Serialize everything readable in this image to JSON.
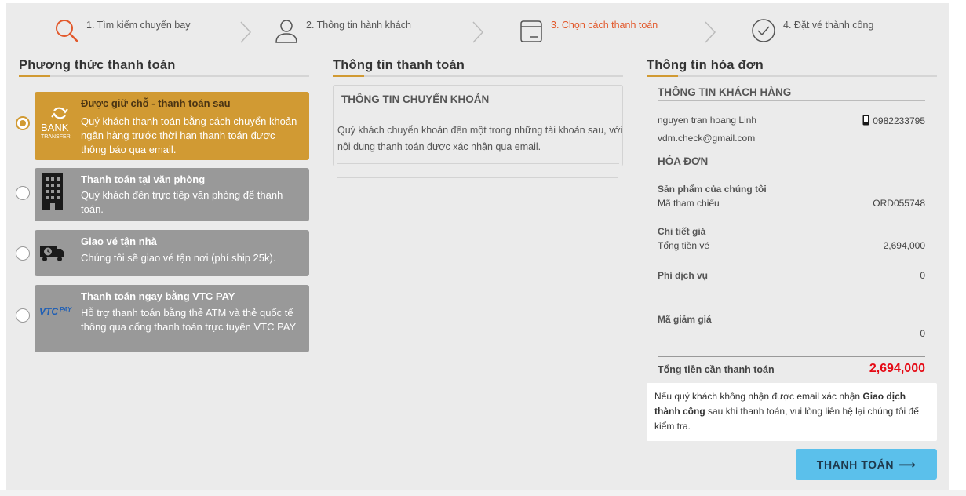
{
  "stepper": {
    "steps": [
      {
        "label": "1. Tìm kiếm chuyến bay",
        "icon": "search-icon"
      },
      {
        "label": "2. Thông tin hành khách",
        "icon": "user-icon"
      },
      {
        "label": "3. Chọn cách thanh toán",
        "icon": "wallet-icon",
        "active": true
      },
      {
        "label": "4. Đặt vé thành công",
        "icon": "check-circle-icon"
      }
    ],
    "active_color": "#e2592c"
  },
  "payment_methods": {
    "heading": "Phương thức thanh toán",
    "options": [
      {
        "title": "Được giữ chỗ - thanh toán sau",
        "desc": "Quý khách thanh toán bằng cách chuyển khoản ngân hàng trước thời hạn thanh toán được thông báo qua email.",
        "icon": "bank-transfer-icon",
        "icon_text_1": "BANK",
        "icon_text_2": "TRANSFER",
        "selected": true
      },
      {
        "title": "Thanh toán tại văn phòng",
        "desc": "Quý khách đến trực tiếp văn phòng để thanh toán.",
        "icon": "building-icon"
      },
      {
        "title": "Giao vé tận nhà",
        "desc": "Chúng tôi sẽ giao vé tận nơi (phí ship 25k).",
        "icon": "delivery-truck-icon"
      },
      {
        "title": "Thanh toán ngay bằng VTC PAY",
        "desc": "Hỗ trợ thanh toán bằng thẻ ATM và thẻ quốc tế thông qua cổng thanh toán trực tuyến VTC PAY",
        "icon": "vtc-pay-logo"
      }
    ]
  },
  "payment_info": {
    "heading": "Thông tin thanh toán",
    "box_title": "THÔNG TIN CHUYỂN KHOẢN",
    "box_text": "Quý khách chuyển khoản đến một trong những tài khoản sau, với nội dung thanh toán được xác nhận qua email."
  },
  "invoice": {
    "heading": "Thông tin hóa đơn",
    "customer_section": "THÔNG TIN KHÁCH HÀNG",
    "customer_name": "nguyen tran hoang Linh",
    "customer_phone": "0982233795",
    "customer_email": "vdm.check@gmail.com",
    "invoice_section": "HÓA ĐƠN",
    "product_label": "Sản phẩm của chúng tôi",
    "ref_label": "Mã tham chiếu",
    "ref_value": "ORD055748",
    "price_detail_label": "Chi tiết giá",
    "ticket_total_label": "Tổng tiền vé",
    "ticket_total_value": "2,694,000",
    "service_fee_label": "Phí dịch vụ",
    "service_fee_value": "0",
    "discount_label": "Mã giảm giá",
    "discount_value": "0",
    "grand_total_label": "Tổng tiền cần thanh toán",
    "grand_total_value": "2,694,000"
  },
  "note": {
    "part1": "Nếu quý khách không nhận được email xác nhận ",
    "bold": "Giao dịch thành công",
    "part2": " sau khi thanh toán, vui lòng liên hệ lại chúng tôi để kiểm tra."
  },
  "pay_button": {
    "label": "THANH TOÁN",
    "arrow": "⟶"
  },
  "colors": {
    "accent": "#d19a33",
    "button": "#5bc0eb",
    "total": "#e50914",
    "option_gray": "#999999"
  }
}
